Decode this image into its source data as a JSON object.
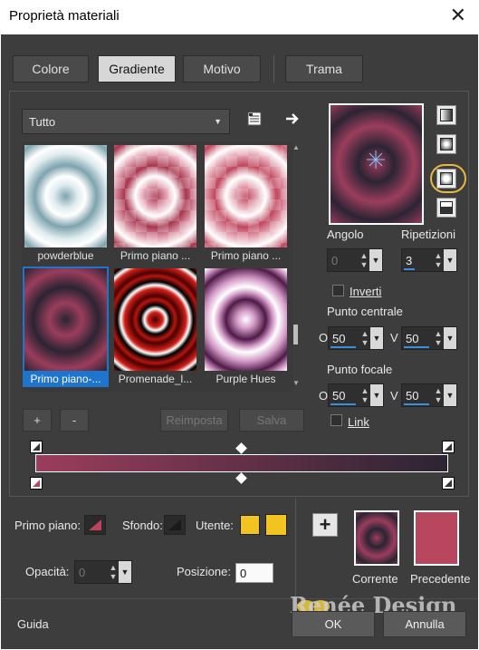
{
  "window": {
    "title": "Proprietà materiali",
    "close_glyph": "✕"
  },
  "tabs": [
    {
      "label": "Colore",
      "active": false
    },
    {
      "label": "Gradiente",
      "active": true
    },
    {
      "label": "Motivo",
      "active": false
    },
    {
      "label": "Trama",
      "active": false
    }
  ],
  "library": {
    "category": "Tutto",
    "items": [
      {
        "caption": "powderblue",
        "selected": false
      },
      {
        "caption": "Primo piano ...",
        "selected": false
      },
      {
        "caption": "Primo piano ...",
        "selected": false
      },
      {
        "caption": "Primo piano-...",
        "selected": true
      },
      {
        "caption": "Promenade_l...",
        "selected": false
      },
      {
        "caption": "Purple Hues",
        "selected": false
      }
    ],
    "add_label": "+",
    "remove_label": "-",
    "reset_label": "Reimposta",
    "save_label": "Salva"
  },
  "params": {
    "angle_label": "Angolo",
    "angle_value": "0",
    "repeats_label": "Ripetizioni",
    "repeats_value": "3",
    "invert_label": "Inverti",
    "center_label": "Punto centrale",
    "center_o_label": "O",
    "center_o_value": "50",
    "center_v_label": "V",
    "center_v_value": "50",
    "focal_label": "Punto focale",
    "focal_o_label": "O",
    "focal_o_value": "50",
    "focal_v_label": "V",
    "focal_v_value": "50",
    "link_label": "Link"
  },
  "bottom": {
    "foreground_label": "Primo piano:",
    "background_label": "Sfondo:",
    "user_label": "Utente:",
    "opacity_label": "Opacità:",
    "opacity_value": "0",
    "position_label": "Posizione:",
    "position_value": "0",
    "plus_label": "+",
    "current_label": "Corrente",
    "previous_label": "Precedente"
  },
  "footer": {
    "help_label": "Guida",
    "ok_label": "OK",
    "cancel_label": "Annulla",
    "watermark": "Renée Design"
  },
  "colors": {
    "gradient_start": "#9b3d5c",
    "gradient_end": "#2b2433",
    "user_color": "#f2c421",
    "previous_color": "#b8465f",
    "highlight_ring": "#e7b93b"
  }
}
